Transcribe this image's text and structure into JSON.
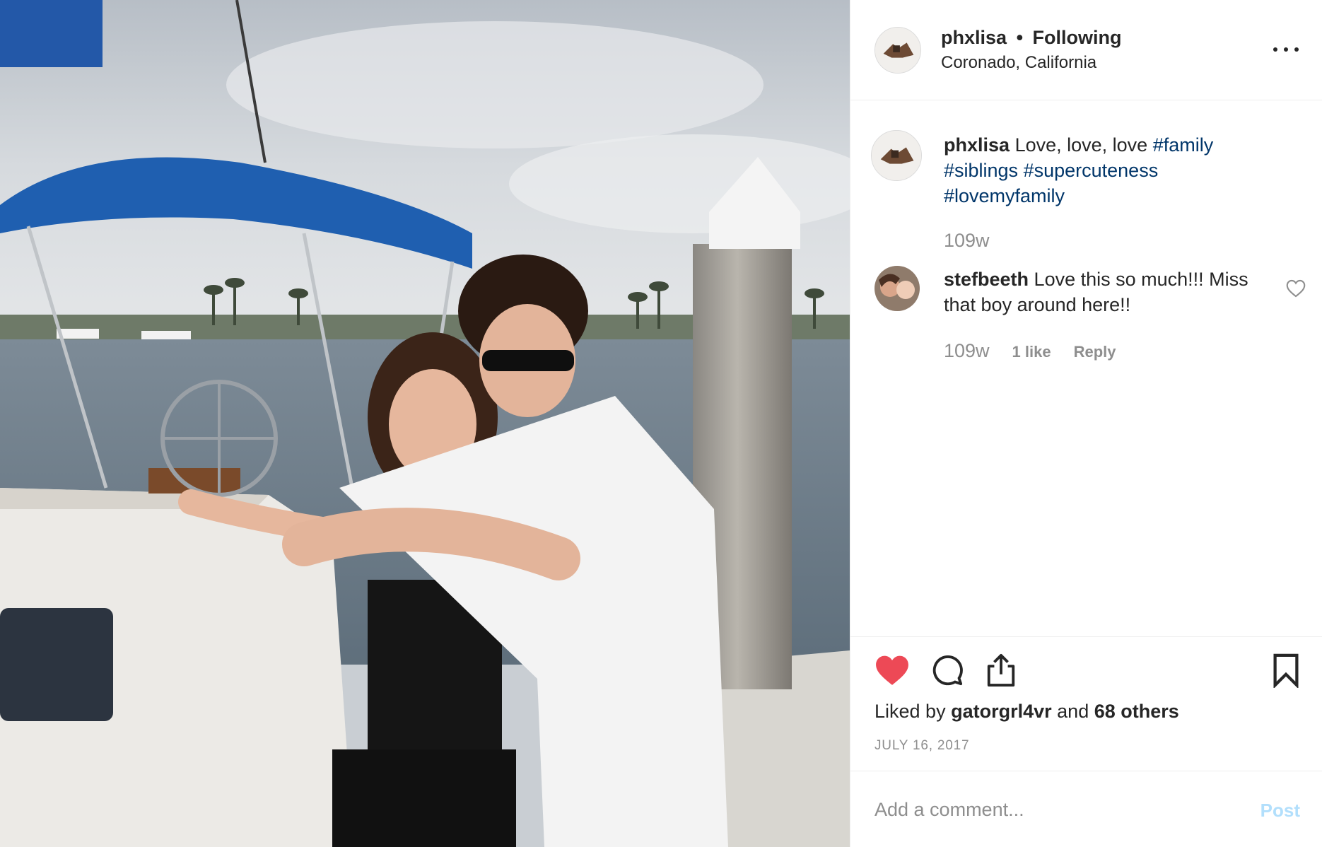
{
  "post": {
    "username": "phxlisa",
    "separator": "•",
    "follow_status": "Following",
    "location": "Coronado, California"
  },
  "caption": {
    "username": "phxlisa",
    "text": "Love, love, love",
    "hashtags": [
      "#family",
      "#siblings",
      "#supercuteness",
      "#lovemyfamily"
    ],
    "time": "109w"
  },
  "comment": {
    "username": "stefbeeth",
    "text": "Love this so much!!! Miss that boy around here!!",
    "time": "109w",
    "likes": "1 like",
    "reply_label": "Reply"
  },
  "engagement": {
    "liked_by_prefix": "Liked by",
    "liked_by_user": "gatorgrl4vr",
    "and_label": "and",
    "others_label": "68 others",
    "date": "JULY 16, 2017"
  },
  "add_comment": {
    "placeholder": "Add a comment...",
    "post_label": "Post"
  },
  "icons": {
    "more": "more-options-icon",
    "like": "heart-filled-icon",
    "comment": "comment-bubble-icon",
    "share": "share-icon",
    "save": "bookmark-icon",
    "comment_like": "heart-outline-icon"
  },
  "colors": {
    "heart": "#ed4956",
    "hashtag": "#003569",
    "muted": "#8e8e8e",
    "post_button": "#b2dffc"
  }
}
